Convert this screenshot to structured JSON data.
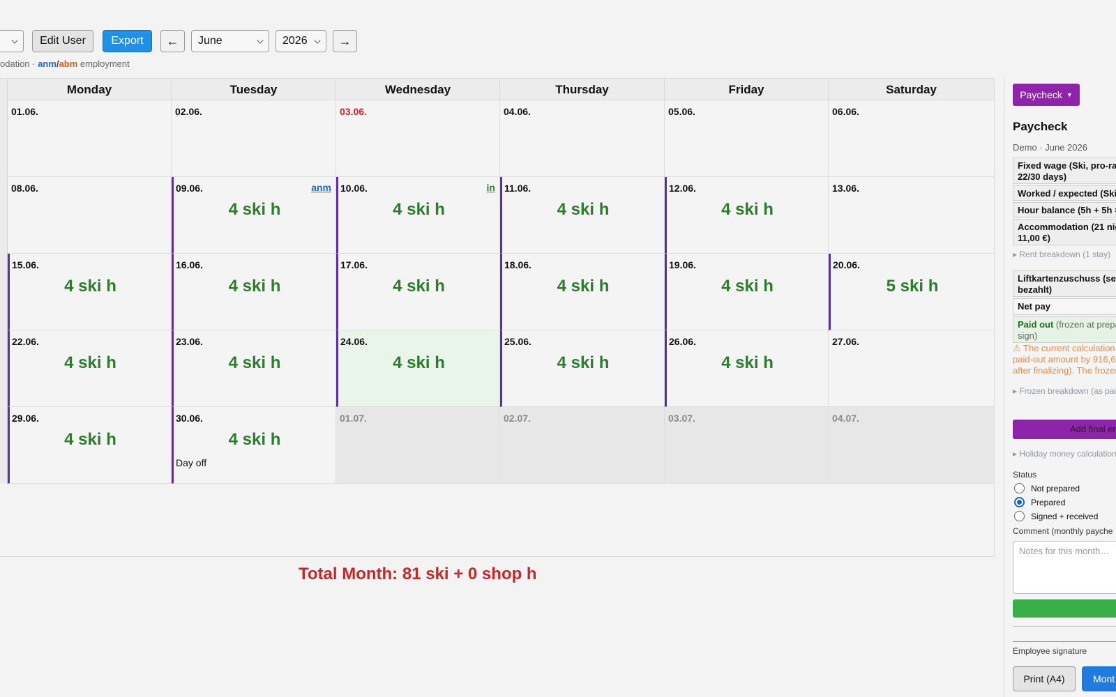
{
  "toolbar": {
    "edit_user_label": "Edit User",
    "export_label": "Export",
    "prev_label": "←",
    "next_label": "→",
    "month_value": "June",
    "year_value": "2026"
  },
  "legend": {
    "prefix": "odation · ",
    "anm": "anm",
    "slash": "/",
    "abm": "abm",
    "suffix": " employment"
  },
  "calendar": {
    "day_names": [
      "Monday",
      "Tuesday",
      "Wednesday",
      "Thursday",
      "Friday",
      "Saturday"
    ],
    "weeks": [
      [
        {
          "date": "01.06.",
          "hours": "",
          "tag": "",
          "note": ""
        },
        {
          "date": "02.06.",
          "hours": "",
          "tag": "",
          "note": ""
        },
        {
          "date": "03.06.",
          "hours": "",
          "tag": "",
          "note": ""
        },
        {
          "date": "04.06.",
          "hours": "",
          "tag": "",
          "note": ""
        },
        {
          "date": "05.06.",
          "hours": "",
          "tag": "",
          "note": ""
        },
        {
          "date": "06.06.",
          "hours": "",
          "tag": "",
          "note": ""
        }
      ],
      [
        {
          "date": "08.06.",
          "hours": "",
          "tag": "",
          "note": ""
        },
        {
          "date": "09.06.",
          "hours": "4 ski h",
          "tag": "anm",
          "note": ""
        },
        {
          "date": "10.06.",
          "hours": "4 ski h",
          "tag": "in",
          "note": ""
        },
        {
          "date": "11.06.",
          "hours": "4 ski h",
          "tag": "",
          "note": ""
        },
        {
          "date": "12.06.",
          "hours": "4 ski h",
          "tag": "",
          "note": ""
        },
        {
          "date": "13.06.",
          "hours": "",
          "tag": "",
          "note": ""
        }
      ],
      [
        {
          "date": "15.06.",
          "hours": "4 ski h",
          "tag": "",
          "note": ""
        },
        {
          "date": "16.06.",
          "hours": "4 ski h",
          "tag": "",
          "note": ""
        },
        {
          "date": "17.06.",
          "hours": "4 ski h",
          "tag": "",
          "note": ""
        },
        {
          "date": "18.06.",
          "hours": "4 ski h",
          "tag": "",
          "note": ""
        },
        {
          "date": "19.06.",
          "hours": "4 ski h",
          "tag": "",
          "note": ""
        },
        {
          "date": "20.06.",
          "hours": "5 ski h",
          "tag": "",
          "note": ""
        }
      ],
      [
        {
          "date": "22.06.",
          "hours": "4 ski h",
          "tag": "",
          "note": ""
        },
        {
          "date": "23.06.",
          "hours": "4 ski h",
          "tag": "",
          "note": ""
        },
        {
          "date": "24.06.",
          "hours": "4 ski h",
          "tag": "",
          "note": ""
        },
        {
          "date": "25.06.",
          "hours": "4 ski h",
          "tag": "",
          "note": ""
        },
        {
          "date": "26.06.",
          "hours": "4 ski h",
          "tag": "",
          "note": ""
        },
        {
          "date": "27.06.",
          "hours": "",
          "tag": "",
          "note": ""
        }
      ],
      [
        {
          "date": "29.06.",
          "hours": "4 ski h",
          "tag": "",
          "note": ""
        },
        {
          "date": "30.06.",
          "hours": "4 ski h",
          "tag": "",
          "note": "Day off"
        },
        {
          "date": "01.07.",
          "hours": "",
          "tag": "",
          "note": ""
        },
        {
          "date": "02.07.",
          "hours": "",
          "tag": "",
          "note": ""
        },
        {
          "date": "03.07.",
          "hours": "",
          "tag": "",
          "note": ""
        },
        {
          "date": "04.07.",
          "hours": "",
          "tag": "",
          "note": ""
        }
      ]
    ],
    "total": "Total Month: 81 ski + 0 shop h"
  },
  "paycheck": {
    "button_label": "Paycheck",
    "title": "Paycheck",
    "subtitle": "Demo · June 2026",
    "fixed_wage": "Fixed wage (Ski, pro-rate 22/30 days)",
    "worked_expected": "Worked / expected (Ski)",
    "hour_balance": "Hour balance (5h + 5h =",
    "accommodation": "Accommodation (21 nigh 11,00 €)",
    "rent_breakdown": "▸ Rent breakdown (1 stay)",
    "liftkarten": "Liftkartenzuschuss (selb bezahlt)",
    "net_pay": "Net pay",
    "paid_out_label": "Paid out",
    "paid_out_rest": " (frozen at prepar sign)",
    "warning": "⚠ The current calculation ( paid-out amount by 916,67 after finalizing). The frozen",
    "frozen_breakdown": "▸ Frozen breakdown (as paid",
    "add_final_label": "Add final en",
    "holiday_money": "▸ Holiday money calculation",
    "status_label": "Status",
    "status_options": [
      "Not prepared",
      "Prepared",
      "Signed + received"
    ],
    "status_selected": "Prepared",
    "comment_label": "Comment (monthly payche",
    "comment_placeholder": "Notes for this month…",
    "signature_label": "Employee signature",
    "print_label": "Print (A4)",
    "month_label": "Mont"
  },
  "colors": {
    "accent_blue": "#1e90e8",
    "worked_border": "#5b2fa8",
    "hours_green": "#2b7d2b",
    "total_red": "#c62828",
    "paycheck_purple": "#8e24aa",
    "save_green": "#3aae48"
  }
}
